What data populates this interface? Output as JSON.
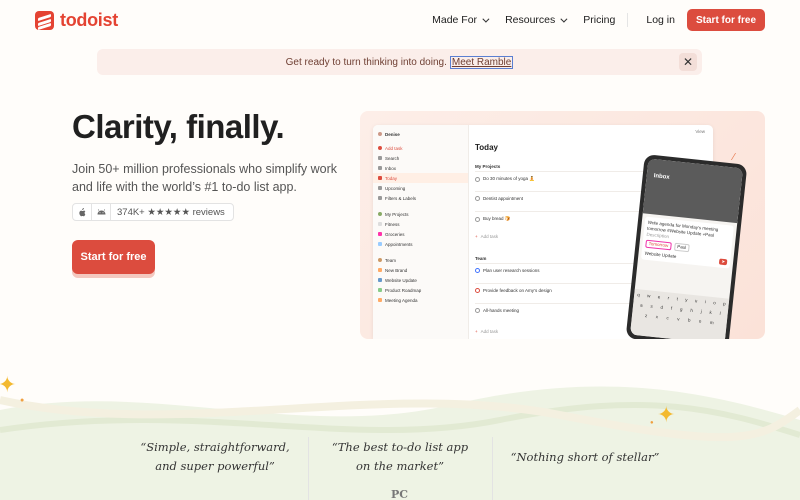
{
  "header": {
    "logo": "todoist",
    "nav": [
      "Made For",
      "Resources",
      "Pricing"
    ],
    "login": "Log in",
    "cta": "Start for free"
  },
  "banner": {
    "text": "Get ready to turn thinking into doing.",
    "link": "Meet Ramble",
    "close_icon": "close-icon"
  },
  "hero": {
    "title": "Clarity, finally.",
    "subtitle": "Join 50+ million professionals who simplify work and life with the world’s #1 to-do list app.",
    "reviews": "374K+ ★★★★★ reviews",
    "cta": "Start for free"
  },
  "preview": {
    "user": "Denise",
    "view": "View",
    "sidebar": [
      "Add task",
      "Search",
      "Inbox",
      "Today",
      "Upcoming",
      "Filters & Labels",
      "My Projects",
      "Fitness",
      "Groceries",
      "Appointments",
      "Team",
      "New Brand",
      "Website Update",
      "Product Roadmap",
      "Meeting Agenda"
    ],
    "main_title": "Today",
    "section_projects": "My Projects",
    "tasks_projects": [
      "Do 30 minutes of yoga 🧘",
      "Dentist appointment",
      "Buy bread 🍞"
    ],
    "add_task": "Add task",
    "section_team": "Team",
    "tasks_team": [
      "Plan user research sessions",
      "Provide feedback on Amy’s design",
      "All-hands meeting"
    ],
    "phone": {
      "title": "Inbox",
      "task": "Write agenda for Monday’s meeting tomorrow #Website Update +Paul",
      "description": "Description",
      "chips": [
        "Tomorrow",
        "Paul"
      ],
      "project": "Website Update",
      "keys_row1": [
        "q",
        "w",
        "e",
        "r",
        "t",
        "y",
        "u",
        "i",
        "o",
        "p"
      ],
      "keys_row2": [
        "a",
        "s",
        "d",
        "f",
        "g",
        "h",
        "j",
        "k",
        "l"
      ],
      "keys_row3": [
        "z",
        "x",
        "c",
        "v",
        "b",
        "n",
        "m"
      ]
    }
  },
  "testimonials": [
    {
      "line1": "“Simple, straightforward,",
      "line2": "and super powerful”"
    },
    {
      "line1": "“The best to-do list app",
      "line2": "on the market”"
    },
    {
      "line1": "“Nothing short of stellar”",
      "line2": ""
    }
  ],
  "press_logo": "PC"
}
